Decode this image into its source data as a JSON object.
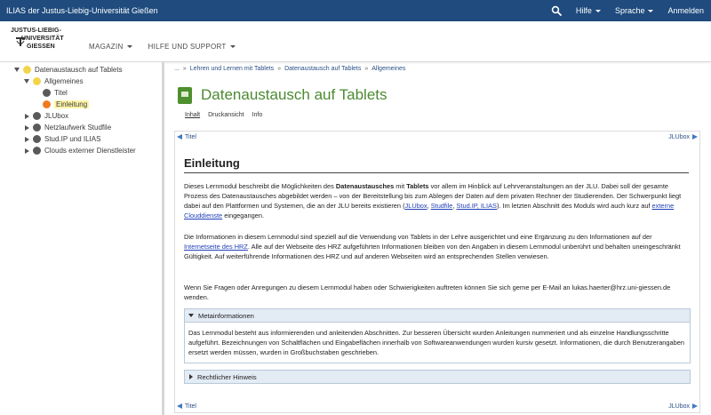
{
  "topbar": {
    "title": "ILIAS der Justus-Liebig-Universität Gießen",
    "help": "Hilfe",
    "language": "Sprache",
    "login": "Anmelden"
  },
  "logo": {
    "line1": "JUSTUS-LIEBIG-",
    "line2": "UNIVERSITÄT",
    "line3": "GIESSEN"
  },
  "nav": {
    "magazin": "MAGAZIN",
    "support": "HILFE UND SUPPORT"
  },
  "tree": {
    "items": [
      {
        "label": "Datenaustausch auf Tablets"
      },
      {
        "label": "Allgemeines"
      },
      {
        "label": "Titel"
      },
      {
        "label": "Einleitung"
      },
      {
        "label": "JLUbox"
      },
      {
        "label": "Netzlaufwerk Studfile"
      },
      {
        "label": "Stud.IP und ILIAS"
      },
      {
        "label": "Clouds externer Dienstleister"
      }
    ]
  },
  "breadcrumb": {
    "start": "...",
    "items": [
      "Lehren und Lernen mit Tablets",
      "Datenaustausch auf Tablets",
      "Allgemeines"
    ]
  },
  "page": {
    "title": "Datenaustausch auf Tablets",
    "tabs": [
      "Inhalt",
      "Druckansicht",
      "Info"
    ]
  },
  "panel_nav": {
    "prev": "Titel",
    "next": "JLUbox"
  },
  "content": {
    "heading": "Einleitung",
    "p1": {
      "a": "Dieses Lernmodul beschreibt die Möglichkeiten des ",
      "b": "Datenaustausches",
      "c": " mit ",
      "d": "Tablets",
      "e": " vor allem im Hinblick auf Lehrveranstaltungen an der JLU. Dabei soll der gesamte Prozess des Datenaustausches abgebildet werden – von der Bereitstellung bis zum Ablegen der Daten auf dem privaten Rechner der Studierenden. Der Schwerpunkt liegt dabei auf den Plattformen und Systemen, die an der JLU bereits existieren (",
      "link1": "JLUbox",
      "sep1": ", ",
      "link2": "Studfile",
      "sep2": ", ",
      "link3": "Stud.IP, ILIAS",
      "f": "). Im letzten Abschnitt des Moduls wird auch kurz auf ",
      "link4": "externe Clouddienste",
      "g": " eingegangen."
    },
    "p2": {
      "a": "Die Informationen in diesem Lernmodul sind speziell auf die Verwendung von Tablets in der Lehre ausgerichtet und eine Ergänzung zu den Informationen auf der ",
      "link": "Internetseite des HRZ",
      "b": ". Alle auf der Webseite des HRZ aufgeführten Informationen bleiben von den Angaben in diesem Lernmodul unberührt und behalten uneingeschränkt Gültigkeit. Auf weiterführende Informationen des HRZ und auf anderen Webseiten wird an entsprechenden Stellen verwiesen."
    },
    "p3": "Wenn Sie Fragen oder Anregungen zu diesem Lernmodul haben oder Schwierigkeiten auftreten können Sie sich gerne per E-Mail an lukas.haerter@hrz.uni-giessen.de wenden.",
    "meta": {
      "title": "Metainformationen",
      "body": "Das Lernmodul besteht aus informierenden und anleitenden Abschnitten. Zur besseren Übersicht wurden Anleitungen nummeriert und als einzelne Handlungsschritte aufgeführt. Bezeichnungen von Schaltflächen und Eingabeflächen innerhalb von Softwareanwendungen wurden kursiv gesetzt. Informationen, die durch Benutzerangaben ersetzt werden müssen, wurden in Großbuchstaben geschrieben."
    },
    "legal": {
      "title": "Rechtlicher Hinweis"
    }
  },
  "colors": {
    "topbar": "#1f4b7e",
    "title_green": "#4c8a32",
    "link": "#2140b8",
    "accordion_head": "#e3ebf4"
  }
}
